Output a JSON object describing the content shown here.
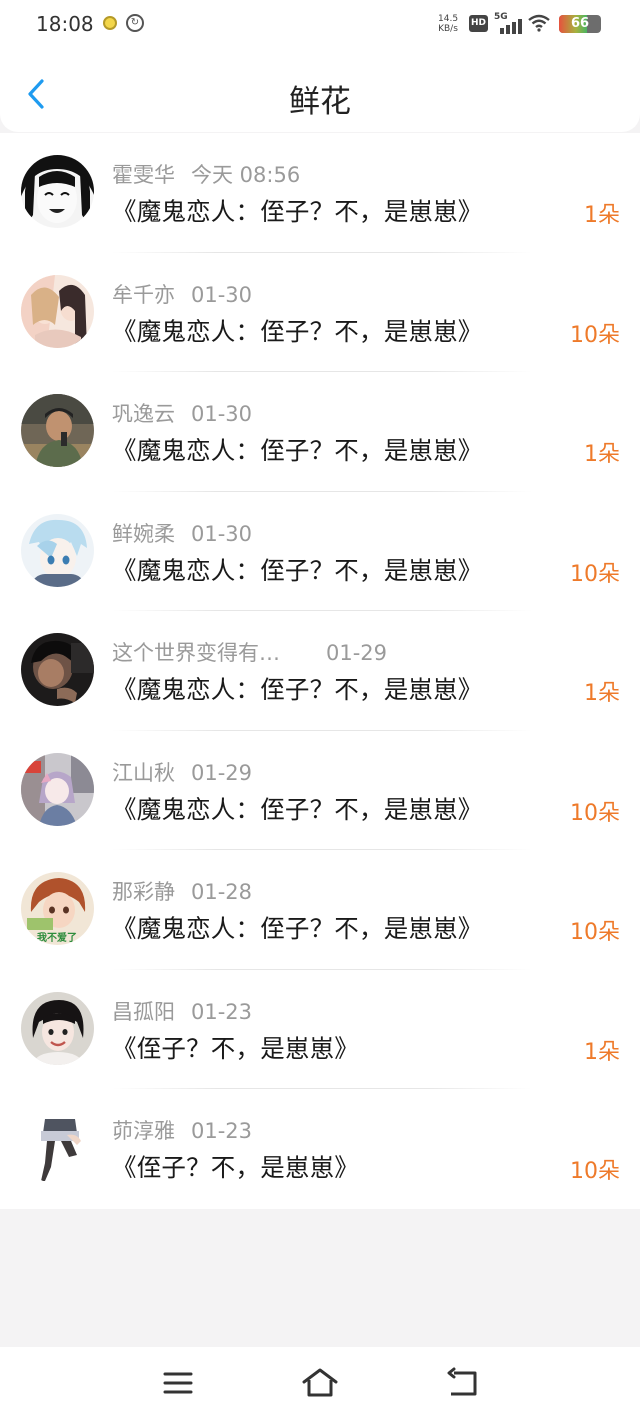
{
  "status_bar": {
    "time": "18:08",
    "net_speed_value": "14.5",
    "net_speed_unit": "KB/s",
    "hd_label": "HD",
    "network_label": "5G",
    "battery": "66"
  },
  "header": {
    "title": "鲜花",
    "back_icon": "chevron-left-icon"
  },
  "colors": {
    "accent_blue": "#1e9bf0",
    "quantity_orange": "#ee7a2a",
    "meta_gray": "#9a9a9a"
  },
  "gifts": [
    {
      "user": "霍雯华",
      "time": "今天 08:56",
      "book": "《魔鬼恋人：侄子？不，是崽崽》",
      "qty": "1朵"
    },
    {
      "user": "牟千亦",
      "time": "01-30",
      "book": "《魔鬼恋人：侄子？不，是崽崽》",
      "qty": "10朵"
    },
    {
      "user": "巩逸云",
      "time": "01-30",
      "book": "《魔鬼恋人：侄子？不，是崽崽》",
      "qty": "1朵"
    },
    {
      "user": "鲜婉柔",
      "time": "01-30",
      "book": "《魔鬼恋人：侄子？不，是崽崽》",
      "qty": "10朵"
    },
    {
      "user": "这个世界变得有…",
      "time": "01-29",
      "book": "《魔鬼恋人：侄子？不，是崽崽》",
      "qty": "1朵"
    },
    {
      "user": "江山秋",
      "time": "01-29",
      "book": "《魔鬼恋人：侄子？不，是崽崽》",
      "qty": "10朵"
    },
    {
      "user": "那彩静",
      "time": "01-28",
      "book": "《魔鬼恋人：侄子？不，是崽崽》",
      "qty": "10朵"
    },
    {
      "user": "昌孤阳",
      "time": "01-23",
      "book": "《侄子？不，是崽崽》",
      "qty": "1朵"
    },
    {
      "user": "茆淳雅",
      "time": "01-23",
      "book": "《侄子？不，是崽崽》",
      "qty": "10朵"
    }
  ],
  "avatar_overlay_text": "我不爱了",
  "nav": {
    "menu_icon": "menu-icon",
    "home_icon": "home-icon",
    "back_icon": "back-arrow-icon"
  }
}
